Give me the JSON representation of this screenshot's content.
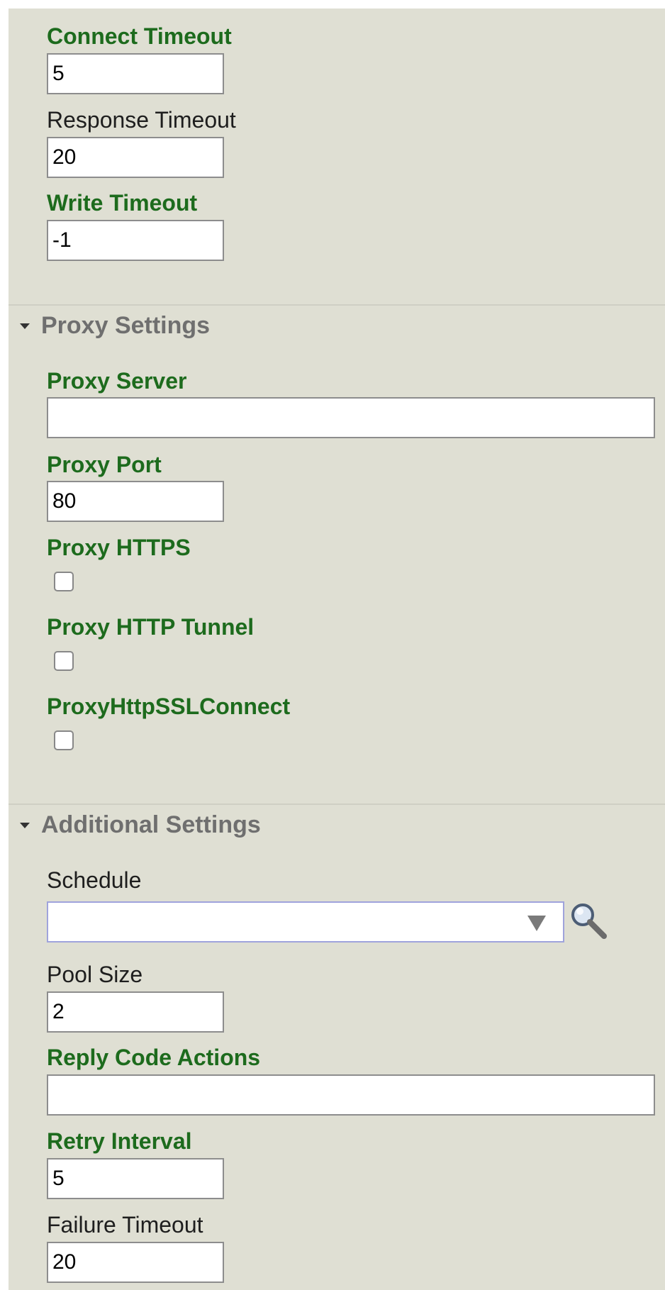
{
  "timeouts": {
    "connect": {
      "label": "Connect Timeout",
      "value": "5"
    },
    "response": {
      "label": "Response Timeout",
      "value": "20"
    },
    "write": {
      "label": "Write Timeout",
      "value": "-1"
    }
  },
  "proxy": {
    "section_title": "Proxy Settings",
    "server": {
      "label": "Proxy Server",
      "value": ""
    },
    "port": {
      "label": "Proxy Port",
      "value": "80"
    },
    "https": {
      "label": "Proxy HTTPS",
      "checked": false
    },
    "http_tunnel": {
      "label": "Proxy HTTP Tunnel",
      "checked": false
    },
    "ssl_connect": {
      "label": "ProxyHttpSSLConnect",
      "checked": false
    }
  },
  "additional": {
    "section_title": "Additional Settings",
    "schedule": {
      "label": "Schedule",
      "selected": ""
    },
    "pool_size": {
      "label": "Pool Size",
      "value": "2"
    },
    "reply_code_actions": {
      "label": "Reply Code Actions",
      "value": ""
    },
    "retry_interval": {
      "label": "Retry Interval",
      "value": "5"
    },
    "failure_timeout": {
      "label": "Failure Timeout",
      "value": "20"
    }
  },
  "colors": {
    "panel_bg": "#dfdfd3",
    "required_label": "#1d6b1d",
    "optional_label": "#1e1e1e",
    "section_header": "#6f6f6f"
  },
  "icons": {
    "collapse": "triangle-down-icon",
    "lookup": "magnifier-icon",
    "dropdown": "chevron-down-icon"
  }
}
